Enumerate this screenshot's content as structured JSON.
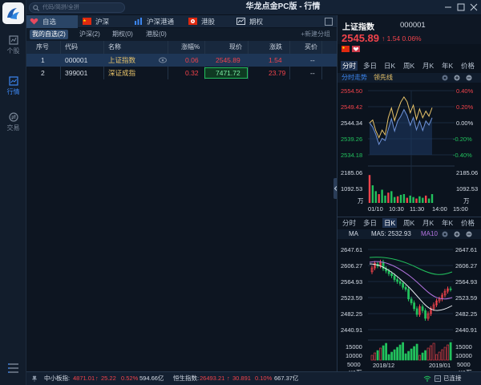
{
  "app": {
    "title": "华龙点金PC版 - 行情"
  },
  "search": {
    "placeholder": "代码/简拼/全拼"
  },
  "rail": {
    "items": [
      {
        "label": "个股",
        "icon": "stock-icon"
      },
      {
        "label": "行情",
        "icon": "market-icon"
      },
      {
        "label": "交易",
        "icon": "trade-icon"
      }
    ]
  },
  "tabs": [
    {
      "label": "自选",
      "icon": "heart-icon"
    },
    {
      "label": "沪深",
      "icon": "china-flag-icon"
    },
    {
      "label": "沪深港通",
      "icon": "connect-icon"
    },
    {
      "label": "港股",
      "icon": "hk-flag-icon"
    },
    {
      "label": "期权",
      "icon": "options-icon"
    }
  ],
  "subtabs": [
    {
      "label": "我的自选(2)"
    },
    {
      "label": "沪深(2)"
    },
    {
      "label": "期权(0)"
    },
    {
      "label": "港股(0)"
    }
  ],
  "new_group": "+新建分组",
  "table": {
    "headers": [
      "序号",
      "代码",
      "名称",
      "涨幅%",
      "现价",
      "涨跌",
      "买价"
    ],
    "rows": [
      {
        "no": "1",
        "code": "000001",
        "name": "上证指数",
        "pct": "0.06",
        "price": "2545.89",
        "chg": "1.54",
        "bid": "--"
      },
      {
        "no": "2",
        "code": "399001",
        "name": "深证成指",
        "pct": "0.32",
        "price": "7471.72",
        "chg": "23.79",
        "bid": "--"
      }
    ]
  },
  "quote": {
    "name": "上证指数",
    "code": "000001",
    "price": "2545.89",
    "change": "↑ 1.54 0.06%"
  },
  "periods_top": [
    "分时",
    "多日",
    "日K",
    "周K",
    "月K",
    "年K",
    "价格"
  ],
  "periods_bottom": [
    "分时",
    "多日",
    "日K",
    "周K",
    "月K",
    "年K",
    "价格"
  ],
  "intraday": {
    "label": "分时走势",
    "label2": "领先线",
    "price_ticks": [
      "2554.50",
      "2549.42",
      "2544.34",
      "2539.26",
      "2534.18"
    ],
    "pct_ticks": [
      "0.40%",
      "0.20%",
      "0.00%",
      "-0.20%",
      "-0.40%"
    ],
    "vol_ticks": [
      "2185.06",
      "1092.53",
      "万"
    ],
    "time_ticks": [
      "01/10",
      "10:30",
      "11:30",
      "14:00",
      "15:00"
    ],
    "series_price": [
      2544.3,
      2545.2,
      2541.8,
      2539.6,
      2542.0,
      2540.5,
      2546.0,
      2549.0,
      2545.0,
      2548.2,
      2550.9,
      2552.5,
      2551.0,
      2547.5,
      2549.9,
      2545.4,
      2548.7,
      2545.9,
      2548.0,
      2546.4,
      2549.1
    ],
    "series_lead": [
      2544.3,
      2543.0,
      2540.6,
      2537.5,
      2539.4,
      2538.7,
      2542.3,
      2545.6,
      2541.7,
      2544.9,
      2546.4,
      2548.5,
      2546.6,
      2543.5,
      2546.0,
      2542.1,
      2544.9,
      2541.9,
      2544.9,
      2543.6,
      2545.9
    ],
    "volume": [
      1900,
      1200,
      800,
      600,
      900,
      500,
      700,
      800,
      400,
      450,
      550,
      600,
      350,
      500,
      400,
      300,
      450,
      350,
      500,
      300,
      600
    ]
  },
  "kline": {
    "ma_label": "MA",
    "ma5": "MA5: 2532.93",
    "ma10": "MA10",
    "price_ticks": [
      "2647.61",
      "2606.27",
      "2564.93",
      "2523.59",
      "2482.25",
      "2440.91"
    ],
    "vol_ticks": [
      "15000",
      "10000",
      "5000",
      "X1万"
    ],
    "date_ticks": [
      "2018/12",
      "2019/01"
    ]
  },
  "status": {
    "sme_label": "中小板指:",
    "sme_value": "4871.01",
    "sme_arrow": "↑",
    "sme_chg": "25.22",
    "sme_pct": "0.52%",
    "sme_amt": "594.66亿",
    "hsi_label": "恒生指数:",
    "hsi_value": "26493.21",
    "hsi_arrow": "↑",
    "hsi_chg": "30.891",
    "hsi_pct": "0.10%",
    "hsi_amt": "667.37亿",
    "conn": "已连接"
  },
  "colors": {
    "up": "#f2434b",
    "down": "#22c15d",
    "accent": "#3c86f0",
    "price_line": "#e9c46a",
    "lead_line": "#ffffff"
  }
}
